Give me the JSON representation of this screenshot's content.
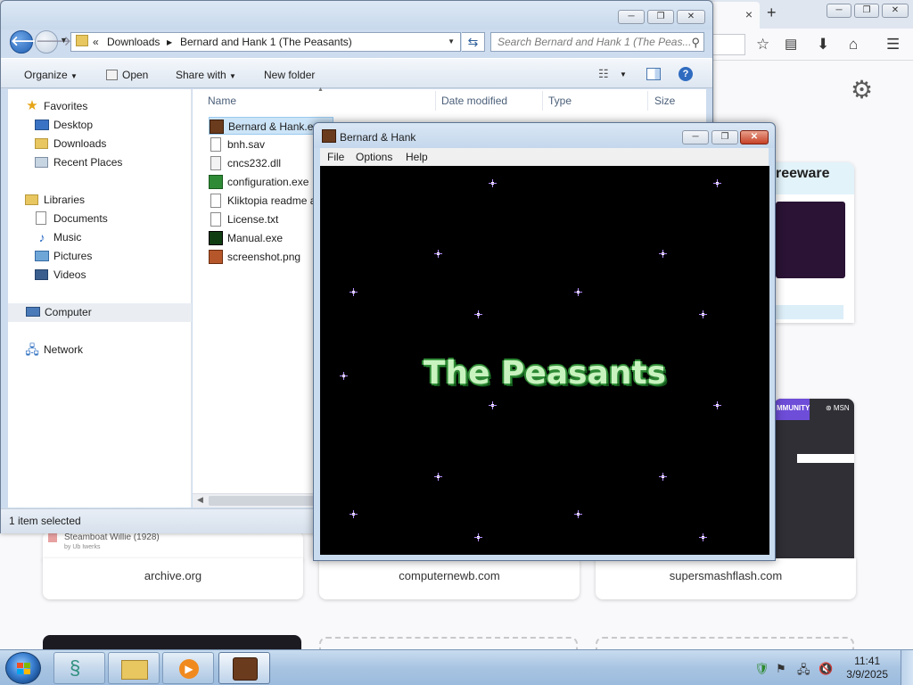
{
  "browser": {
    "tab_close": "×",
    "new_tab": "+",
    "window_controls": [
      "─",
      "❐",
      "✕"
    ],
    "toolbar_icons": [
      "star-icon",
      "reading-list-icon",
      "download-icon",
      "home-icon",
      "menu-icon"
    ],
    "settings_icon": "gear-icon",
    "shortcuts": [
      {
        "label": "archive.org",
        "snippet_title": "Steamboat Willie (1928)",
        "snippet_by": "by Ub Iwerks"
      },
      {
        "label": "computernewb.com"
      },
      {
        "label": "supersmashflash.com"
      }
    ],
    "thumb_texts": {
      "freeware": "reeware",
      "community": "MMUNITY",
      "msn": "⊛ MSN"
    }
  },
  "explorer": {
    "window_controls": [
      "─",
      "❐",
      "✕"
    ],
    "breadcrumb": {
      "chevron": "«",
      "parts": [
        "Downloads",
        "Bernard and Hank 1 (The Peasants)"
      ]
    },
    "search_placeholder": "Search Bernard and Hank 1 (The Peas...",
    "commands": {
      "organize": "Organize",
      "open": "Open",
      "share_with": "Share with",
      "new_folder": "New folder"
    },
    "nav": {
      "favorites": "Favorites",
      "favorites_items": [
        "Desktop",
        "Downloads",
        "Recent Places"
      ],
      "libraries": "Libraries",
      "libraries_items": [
        "Documents",
        "Music",
        "Pictures",
        "Videos"
      ],
      "computer": "Computer",
      "network": "Network"
    },
    "columns": {
      "name": "Name",
      "date_modified": "Date modified",
      "type": "Type",
      "size": "Size"
    },
    "files": [
      "Bernard & Hank.exe",
      "bnh.sav",
      "cncs232.dll",
      "configuration.exe",
      "Kliktopia readme a",
      "License.txt",
      "Manual.exe",
      "screenshot.png"
    ],
    "status": "1 item selected"
  },
  "game": {
    "title": "Bernard & Hank",
    "window_controls": [
      "─",
      "❐",
      "✕"
    ],
    "menu": {
      "file": "File",
      "options": "Options",
      "help": "Help"
    },
    "screen_title": "The Peasants"
  },
  "taskbar": {
    "time": "11:41",
    "date": "3/9/2025",
    "apps": [
      "start-button",
      "snake-app-icon",
      "file-explorer-icon",
      "media-player-icon",
      "bernard-hank-icon"
    ],
    "tray_icons": [
      "security-icon",
      "action-center-flag-icon",
      "network-icon",
      "volume-muted-icon"
    ]
  },
  "colors": {
    "accent": "#3a78c6",
    "game_title_fill": "#c8f3bf",
    "game_title_outline": "#2e8a35",
    "star": "#b58fff"
  }
}
